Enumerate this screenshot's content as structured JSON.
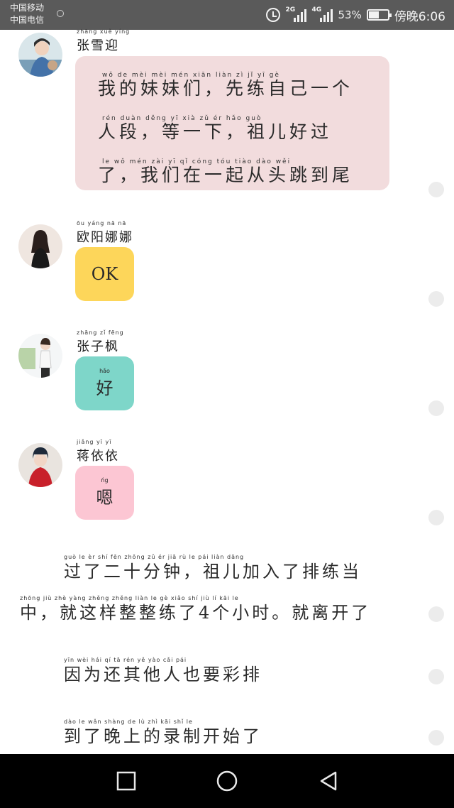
{
  "status_bar": {
    "carrier_1": "中国移动",
    "carrier_2": "中国电信",
    "net_1": "2G",
    "net_2": "4G",
    "battery_percent": "53%",
    "battery_level": 0.53,
    "time": "傍晚6:06"
  },
  "messages": [
    {
      "sender_pinyin": "zhāng xuě yíng",
      "sender": "张雪迎",
      "lines": [
        {
          "pinyin": "wǒ de mèi mèi mén  xiān liàn zì jǐ yī gè",
          "text": "我的妹妹们，先练自己一个"
        },
        {
          "pinyin": "rén duàn  děng yī xià  zǔ ér hǎo guò",
          "text": "人段，等一下，祖儿好过"
        },
        {
          "pinyin": "le  wǒ mén zài yī qǐ cóng tóu tiào dào wěi",
          "text": "了，我们在一起从头跳到尾"
        }
      ],
      "bubble_color": "#f2dcdd"
    },
    {
      "sender_pinyin": "ōu yáng nā nā",
      "sender": "欧阳娜娜",
      "text": "OK",
      "bubble_color": "#fdd65a"
    },
    {
      "sender_pinyin": "zhāng zǐ fēng",
      "sender": "张子枫",
      "text_pinyin": "hǎo",
      "text": "好",
      "bubble_color": "#7ed6c9"
    },
    {
      "sender_pinyin": "jiǎng yī yī",
      "sender": "蒋依依",
      "text_pinyin": "ńg",
      "text": "嗯",
      "bubble_color": "#fcc6d3"
    }
  ],
  "narration": [
    {
      "pinyin": "guò le èr shí fēn zhōng  zǔ ér jiā rù le pái liàn dāng",
      "text": "过了二十分钟，祖儿加入了排练当"
    },
    {
      "pinyin": "zhōng  jiù zhè yàng zhěng zhěng liàn le  gè xiǎo shí  jiù lí kāi le",
      "text": "中，就这样整整练了4个小时。就离开了"
    },
    {
      "pinyin": "yīn wèi hái qí tā rén yě yào cǎi pái",
      "text": "因为还其他人也要彩排"
    },
    {
      "pinyin": "dào le wǎn shàng de lù zhì kāi shǐ le",
      "text": "到了晚上的录制开始了"
    }
  ]
}
